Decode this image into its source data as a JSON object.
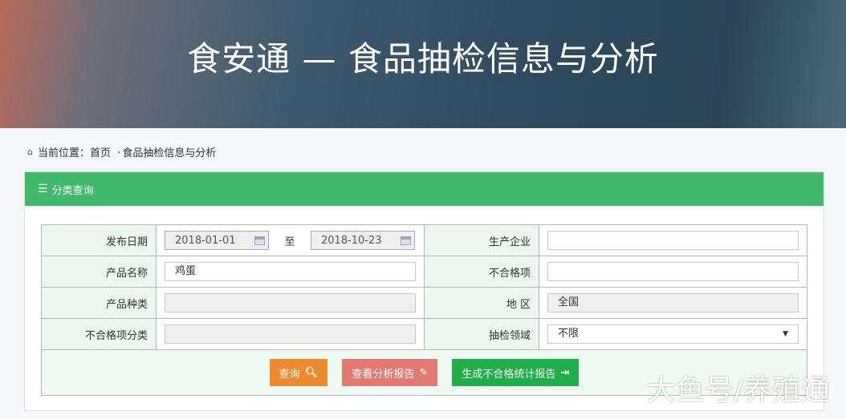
{
  "banner": {
    "title": "食安通 — 食品抽检信息与分析"
  },
  "breadcrumb": {
    "prefix": "当前位置：",
    "home": "首页",
    "current": "食品抽检信息与分析"
  },
  "panel": {
    "title": "分类查询"
  },
  "form": {
    "publish_date_label": "发布日期",
    "date_from": "2018-01-01",
    "date_to_sep": "至",
    "date_to": "2018-10-23",
    "manufacturer_label": "生产企业",
    "manufacturer_value": "",
    "product_name_label": "产品名称",
    "product_name_value": "鸡蛋",
    "unqualified_item_label": "不合格项",
    "unqualified_item_value": "",
    "product_type_label": "产品种类",
    "product_type_value": "",
    "region_label": "地 区",
    "region_value": "全国",
    "unqualified_category_label": "不合格项分类",
    "unqualified_category_value": "",
    "sampling_field_label": "抽检领域",
    "sampling_field_value": "不限"
  },
  "buttons": {
    "search": "查询",
    "view_report": "查看分析报告",
    "generate_report": "生成不合格统计报告"
  },
  "colors": {
    "header": "#3fba6b",
    "search": "#ef8a2e",
    "view": "#e27a72",
    "generate": "#1fae4a"
  },
  "watermark": "大鱼号/养殖通"
}
